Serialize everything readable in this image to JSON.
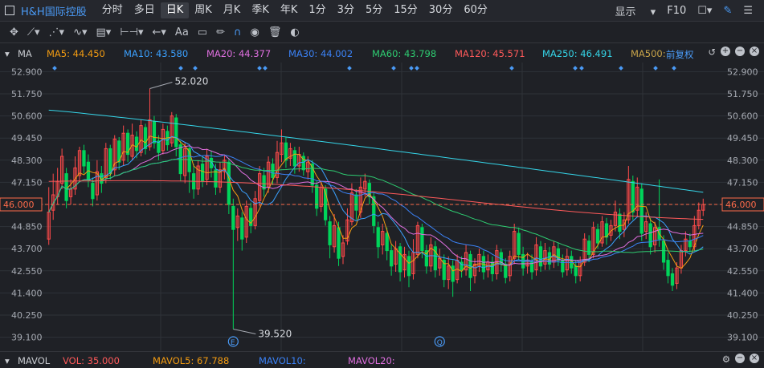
{
  "header": {
    "stock_name": "H&H国际控股",
    "periods": [
      "分时",
      "多日",
      "日K",
      "周K",
      "月K",
      "季K",
      "年K",
      "1分",
      "3分",
      "5分",
      "15分",
      "30分",
      "60分"
    ],
    "active_period": "日K",
    "display_label": "显示",
    "f10_label": "F10"
  },
  "toolbar": {
    "icons": [
      "crosshair-icon",
      "line-draw-icon",
      "channel-icon",
      "wave-icon",
      "fib-icon",
      "measure-icon",
      "arrow-icon",
      "text-icon",
      "comment-icon",
      "pencil-icon",
      "magnet-icon",
      "eye-icon",
      "trash-icon",
      "toggle-icon"
    ],
    "text_tool_label": "Aa"
  },
  "ma_bar": {
    "label": "MA",
    "fq_label": "前复权",
    "items": [
      {
        "text": "MA5: 44.450",
        "color": "#f39c12"
      },
      {
        "text": "MA10: 43.580",
        "color": "#3ba1ff"
      },
      {
        "text": "MA20: 44.377",
        "color": "#e070e0"
      },
      {
        "text": "MA30: 44.002",
        "color": "#3b82f6"
      },
      {
        "text": "MA60: 43.798",
        "color": "#2ecc71"
      },
      {
        "text": "MA120: 45.571",
        "color": "#ff5a5a"
      },
      {
        "text": "MA250: 46.491",
        "color": "#35d5e8"
      },
      {
        "text": "MA500:",
        "color": "#c8a44a"
      }
    ]
  },
  "bottom_bar": {
    "label": "MAVOL",
    "items": [
      {
        "text": "VOL: 35.000",
        "color": "#ff5a5a"
      },
      {
        "text": "MAVOL5: 67.788",
        "color": "#f39c12"
      },
      {
        "text": "MAVOL10:",
        "color": "#3b82f6"
      },
      {
        "text": "MAVOL20:",
        "color": "#e070e0"
      }
    ]
  },
  "colors": {
    "up": "#ff4a4a",
    "down": "#00d45a",
    "price_line": "#ff6b4a",
    "grid": "#2f3238"
  },
  "chart_data": {
    "type": "candlestick",
    "y_ticks": [
      52.9,
      51.75,
      50.6,
      49.45,
      48.3,
      47.15,
      46.0,
      44.85,
      43.7,
      42.55,
      41.4,
      40.25,
      39.1
    ],
    "y_tick_labels": [
      "52.900",
      "51.750",
      "50.600",
      "49.450",
      "48.300",
      "47.150",
      "46.000",
      "44.850",
      "43.700",
      "42.550",
      "41.400",
      "40.250",
      "39.100"
    ],
    "ylim": [
      38.5,
      53.5
    ],
    "current_price": 46.0,
    "current_price_label": "46.000",
    "high_annotation": {
      "index": 23,
      "value": 52.02,
      "label": "52.020"
    },
    "low_annotation": {
      "index": 42,
      "value": 39.52,
      "label": "39.520"
    },
    "event_markers": [
      {
        "index": 42,
        "label": "E"
      },
      {
        "index": 89,
        "label": "Q"
      }
    ],
    "candles": [
      [
        44.2,
        45.6,
        46.9,
        43.9
      ],
      [
        45.7,
        46.5,
        47.6,
        45.2
      ],
      [
        46.4,
        47.2,
        47.9,
        46.0
      ],
      [
        47.1,
        48.5,
        48.9,
        46.8
      ],
      [
        47.6,
        46.2,
        47.9,
        45.8
      ],
      [
        46.4,
        46.8,
        47.3,
        46.0
      ],
      [
        46.8,
        47.9,
        48.5,
        46.5
      ],
      [
        47.5,
        48.8,
        49.0,
        47.2
      ],
      [
        48.8,
        48.0,
        49.1,
        47.6
      ],
      [
        48.2,
        47.3,
        48.6,
        46.9
      ],
      [
        47.1,
        46.3,
        47.4,
        45.9
      ],
      [
        46.5,
        47.7,
        48.3,
        46.2
      ],
      [
        47.6,
        47.1,
        48.0,
        46.6
      ],
      [
        47.4,
        48.9,
        49.2,
        47.1
      ],
      [
        48.9,
        47.6,
        49.1,
        47.3
      ],
      [
        47.8,
        49.4,
        49.6,
        47.5
      ],
      [
        49.3,
        48.2,
        49.5,
        47.8
      ],
      [
        48.3,
        49.7,
        50.1,
        48.0
      ],
      [
        49.7,
        48.6,
        49.9,
        48.2
      ],
      [
        48.5,
        49.6,
        50.2,
        48.3
      ],
      [
        49.5,
        48.8,
        49.8,
        48.4
      ],
      [
        48.7,
        50.1,
        50.4,
        48.5
      ],
      [
        50.0,
        48.9,
        50.2,
        48.6
      ],
      [
        49.0,
        50.4,
        52.02,
        48.8
      ],
      [
        50.3,
        49.2,
        50.6,
        48.9
      ],
      [
        49.3,
        48.7,
        49.6,
        48.3
      ],
      [
        48.8,
        49.9,
        50.2,
        48.6
      ],
      [
        49.8,
        49.1,
        50.1,
        48.8
      ],
      [
        49.2,
        50.6,
        50.8,
        49.0
      ],
      [
        50.5,
        49.0,
        50.7,
        48.5
      ],
      [
        49.1,
        47.6,
        49.3,
        47.2
      ],
      [
        47.5,
        48.9,
        49.2,
        47.1
      ],
      [
        48.9,
        47.7,
        49.0,
        46.6
      ],
      [
        47.6,
        46.8,
        48.1,
        46.3
      ],
      [
        46.8,
        48.0,
        48.3,
        46.5
      ],
      [
        48.1,
        47.2,
        48.5,
        46.9
      ],
      [
        47.3,
        48.5,
        48.9,
        47.0
      ],
      [
        48.4,
        47.9,
        48.8,
        47.4
      ],
      [
        47.8,
        46.9,
        48.1,
        46.5
      ],
      [
        46.9,
        47.8,
        48.2,
        46.6
      ],
      [
        47.7,
        48.3,
        48.6,
        47.3
      ],
      [
        48.2,
        46.0,
        48.4,
        45.5
      ],
      [
        45.9,
        44.7,
        46.3,
        39.52
      ],
      [
        44.8,
        45.4,
        45.8,
        44.1
      ],
      [
        45.3,
        44.2,
        45.6,
        43.6
      ],
      [
        44.3,
        45.9,
        46.2,
        44.0
      ],
      [
        45.8,
        44.9,
        46.1,
        44.5
      ],
      [
        44.9,
        46.3,
        46.7,
        44.7
      ],
      [
        46.2,
        47.6,
        48.0,
        45.9
      ],
      [
        47.5,
        46.8,
        47.9,
        46.4
      ],
      [
        46.9,
        48.2,
        48.5,
        46.6
      ],
      [
        48.1,
        47.4,
        48.4,
        47.0
      ],
      [
        47.4,
        48.7,
        49.3,
        47.1
      ],
      [
        48.6,
        49.2,
        49.9,
        48.2
      ],
      [
        49.2,
        48.3,
        49.5,
        47.9
      ],
      [
        48.4,
        48.9,
        49.2,
        48.0
      ],
      [
        48.8,
        48.0,
        49.0,
        47.6
      ],
      [
        48.0,
        48.6,
        49.0,
        47.7
      ],
      [
        48.5,
        47.8,
        48.7,
        47.5
      ],
      [
        47.7,
        48.2,
        48.5,
        47.3
      ],
      [
        48.1,
        47.0,
        48.3,
        46.6
      ],
      [
        47.0,
        45.8,
        47.2,
        45.4
      ],
      [
        45.9,
        46.9,
        47.2,
        45.6
      ],
      [
        46.8,
        45.2,
        47.0,
        44.9
      ],
      [
        45.1,
        43.9,
        45.4,
        43.2
      ],
      [
        43.8,
        44.9,
        45.5,
        43.5
      ],
      [
        44.8,
        43.2,
        45.1,
        42.8
      ],
      [
        43.3,
        44.0,
        44.4,
        42.9
      ],
      [
        44.1,
        45.2,
        45.8,
        43.9
      ],
      [
        45.1,
        46.6,
        47.1,
        44.9
      ],
      [
        46.5,
        45.7,
        46.8,
        45.2
      ],
      [
        45.6,
        46.9,
        47.4,
        45.3
      ],
      [
        46.8,
        47.2,
        47.6,
        46.4
      ],
      [
        47.1,
        46.4,
        47.3,
        46.0
      ],
      [
        46.4,
        44.9,
        46.6,
        44.5
      ],
      [
        44.8,
        43.8,
        45.1,
        43.2
      ],
      [
        43.9,
        44.6,
        45.0,
        43.4
      ],
      [
        44.5,
        43.6,
        44.8,
        43.1
      ],
      [
        43.6,
        42.8,
        43.9,
        42.3
      ],
      [
        42.9,
        43.7,
        44.1,
        42.5
      ],
      [
        43.8,
        42.5,
        44.0,
        42.0
      ],
      [
        42.6,
        43.4,
        43.8,
        42.2
      ],
      [
        43.3,
        42.3,
        43.6,
        41.7
      ],
      [
        42.4,
        43.5,
        44.2,
        42.1
      ],
      [
        43.4,
        44.9,
        45.1,
        43.2
      ],
      [
        44.8,
        43.6,
        45.0,
        43.2
      ],
      [
        43.6,
        42.8,
        43.9,
        42.4
      ],
      [
        42.8,
        43.9,
        44.3,
        42.5
      ],
      [
        43.8,
        42.6,
        44.1,
        42.2
      ],
      [
        42.7,
        43.2,
        43.7,
        42.3
      ],
      [
        43.1,
        42.1,
        43.4,
        41.7
      ],
      [
        42.1,
        42.8,
        43.3,
        41.6
      ],
      [
        42.8,
        42.0,
        43.1,
        41.2
      ],
      [
        42.1,
        43.1,
        43.4,
        41.9
      ],
      [
        43.0,
        42.6,
        43.3,
        42.2
      ],
      [
        42.6,
        43.5,
        43.9,
        42.3
      ],
      [
        43.4,
        42.2,
        43.6,
        41.5
      ],
      [
        42.3,
        42.9,
        43.2,
        41.9
      ],
      [
        42.8,
        43.4,
        43.7,
        42.5
      ],
      [
        43.3,
        42.5,
        43.6,
        42.1
      ],
      [
        42.6,
        43.0,
        43.4,
        42.2
      ],
      [
        43.0,
        42.4,
        43.3,
        42.0
      ],
      [
        42.4,
        43.6,
        43.9,
        42.1
      ],
      [
        43.5,
        42.9,
        43.7,
        42.5
      ],
      [
        42.9,
        42.2,
        43.2,
        41.9
      ],
      [
        42.3,
        43.3,
        43.6,
        42.0
      ],
      [
        43.2,
        44.6,
        45.0,
        42.9
      ],
      [
        44.5,
        43.4,
        44.8,
        43.1
      ],
      [
        43.4,
        42.7,
        43.8,
        42.3
      ],
      [
        42.8,
        43.1,
        43.5,
        42.4
      ],
      [
        43.0,
        42.5,
        43.4,
        42.1
      ],
      [
        42.6,
        43.9,
        44.3,
        42.3
      ],
      [
        43.8,
        42.8,
        44.1,
        42.5
      ],
      [
        42.9,
        43.6,
        44.0,
        42.6
      ],
      [
        43.5,
        42.9,
        43.8,
        42.6
      ],
      [
        43.0,
        43.8,
        44.1,
        42.7
      ],
      [
        43.7,
        43.1,
        44.0,
        42.8
      ],
      [
        43.1,
        42.5,
        43.4,
        42.2
      ],
      [
        42.6,
        43.3,
        43.7,
        42.3
      ],
      [
        43.3,
        42.7,
        43.6,
        42.4
      ],
      [
        42.8,
        42.3,
        43.1,
        41.9
      ],
      [
        42.3,
        43.0,
        43.3,
        42.0
      ],
      [
        43.0,
        44.2,
        44.5,
        42.8
      ],
      [
        44.1,
        43.4,
        44.4,
        43.0
      ],
      [
        43.4,
        44.8,
        45.1,
        43.2
      ],
      [
        44.7,
        44.0,
        45.0,
        43.7
      ],
      [
        44.0,
        45.1,
        45.4,
        43.8
      ],
      [
        45.0,
        44.3,
        45.3,
        43.9
      ],
      [
        44.4,
        44.9,
        45.2,
        44.1
      ],
      [
        44.9,
        45.6,
        46.2,
        44.6
      ],
      [
        45.5,
        44.6,
        45.8,
        44.2
      ],
      [
        44.7,
        45.2,
        45.6,
        44.3
      ],
      [
        45.2,
        47.3,
        48.0,
        45.0
      ],
      [
        47.2,
        45.6,
        47.5,
        45.2
      ],
      [
        45.7,
        46.9,
        47.4,
        45.4
      ],
      [
        46.8,
        44.5,
        47.1,
        44.1
      ],
      [
        44.6,
        45.1,
        45.6,
        44.2
      ],
      [
        45.0,
        43.8,
        45.3,
        43.4
      ],
      [
        43.9,
        44.8,
        45.1,
        43.5
      ],
      [
        44.8,
        44.2,
        47.3,
        43.8
      ],
      [
        44.1,
        43.0,
        44.4,
        42.6
      ],
      [
        43.1,
        42.3,
        43.5,
        41.9
      ],
      [
        42.4,
        41.8,
        42.7,
        41.5
      ],
      [
        41.9,
        42.7,
        43.0,
        41.6
      ],
      [
        42.7,
        43.6,
        43.9,
        42.4
      ],
      [
        43.6,
        44.2,
        44.6,
        43.3
      ],
      [
        44.1,
        43.8,
        44.5,
        43.5
      ],
      [
        43.8,
        44.9,
        45.4,
        43.6
      ],
      [
        44.9,
        45.7,
        46.1,
        44.7
      ],
      [
        45.7,
        46.0,
        46.3,
        45.4
      ]
    ]
  }
}
